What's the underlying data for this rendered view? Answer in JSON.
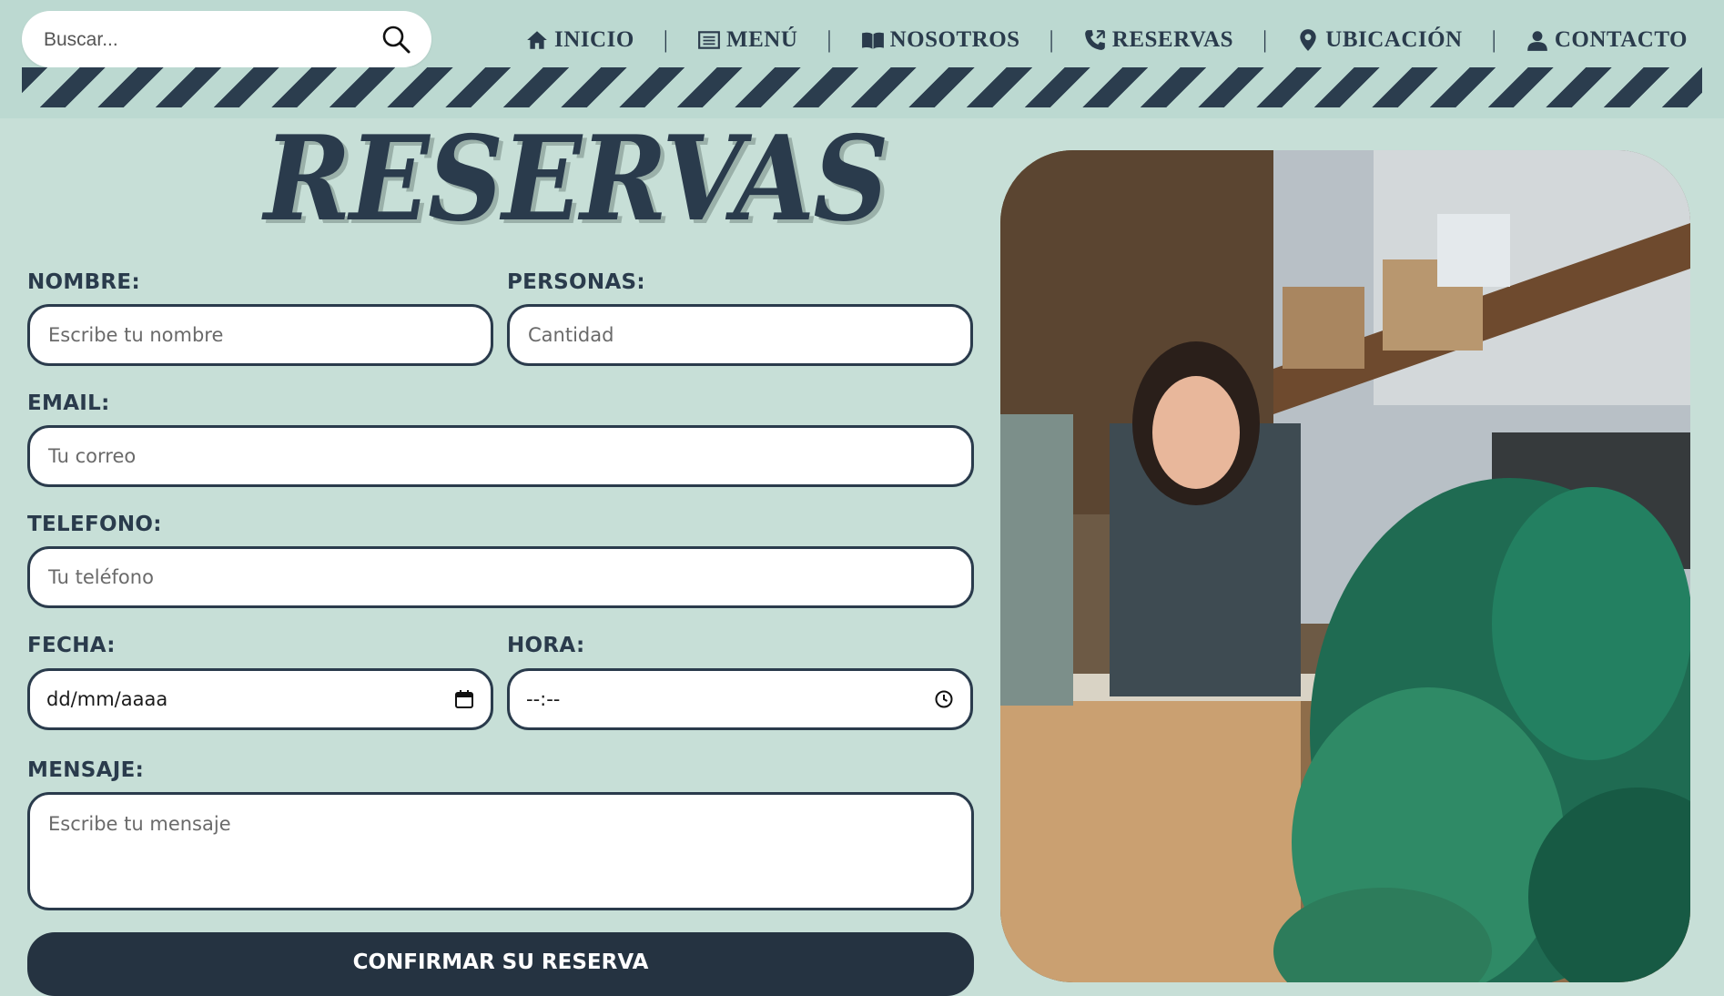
{
  "search": {
    "placeholder": "Buscar..."
  },
  "nav": {
    "items": [
      {
        "label": "INICIO",
        "icon": "home-icon"
      },
      {
        "label": "MENÚ",
        "icon": "list-icon"
      },
      {
        "label": "NOSOTROS",
        "icon": "book-icon"
      },
      {
        "label": "RESERVAS",
        "icon": "phone-icon"
      },
      {
        "label": "UBICACIÓN",
        "icon": "location-pin-icon"
      },
      {
        "label": "CONTACTO",
        "icon": "user-icon"
      }
    ],
    "separator": "|"
  },
  "page": {
    "title": "RESERVAS"
  },
  "form": {
    "nombre": {
      "label": "NOMBRE:",
      "placeholder": "Escribe tu nombre"
    },
    "personas": {
      "label": "PERSONAS:",
      "placeholder": "Cantidad"
    },
    "email": {
      "label": "EMAIL:",
      "placeholder": "Tu correo"
    },
    "telefono": {
      "label": "TELEFONO:",
      "placeholder": "Tu teléfono"
    },
    "fecha": {
      "label": "FECHA:",
      "value": "dd/mm/aaaa",
      "icon": "calendar-icon"
    },
    "hora": {
      "label": "HORA:",
      "value": "--:--",
      "icon": "clock-icon"
    },
    "mensaje": {
      "label": "MENSAJE:",
      "placeholder": "Escribe tu mensaje"
    },
    "submit_label": "CONFIRMAR SU RESERVA"
  },
  "colors": {
    "primary": "#2a3b4c",
    "background": "#c7dfd7",
    "topbar": "#bcd9d1",
    "button": "#253341"
  }
}
